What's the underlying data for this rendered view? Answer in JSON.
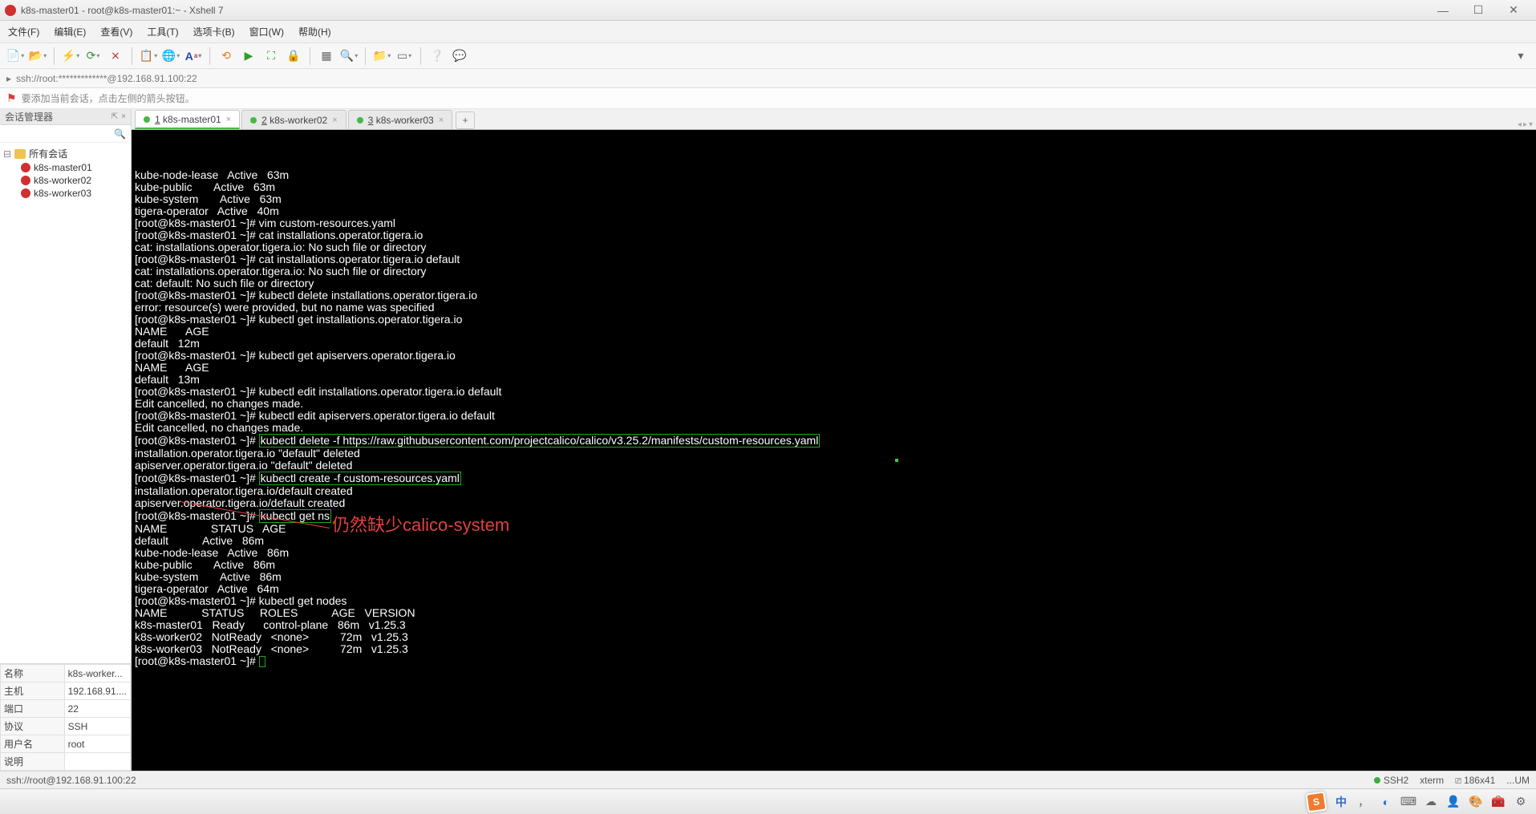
{
  "window": {
    "title": "k8s-master01 - root@k8s-master01:~ - Xshell 7",
    "min": "—",
    "max": "☐",
    "close": "✕"
  },
  "menu": [
    "文件(F)",
    "编辑(E)",
    "查看(V)",
    "工具(T)",
    "选项卡(B)",
    "窗口(W)",
    "帮助(H)"
  ],
  "address_icon": "▸",
  "address": "ssh://root:*************@192.168.91.100:22",
  "hint": "要添加当前会话，点击左侧的箭头按钮。",
  "sidebar": {
    "title": "会话管理器",
    "pin": "⇱",
    "close": "×",
    "root": "所有会话",
    "items": [
      "k8s-master01",
      "k8s-worker02",
      "k8s-worker03"
    ]
  },
  "props": [
    [
      "名称",
      "k8s-worker..."
    ],
    [
      "主机",
      "192.168.91...."
    ],
    [
      "端口",
      "22"
    ],
    [
      "协议",
      "SSH"
    ],
    [
      "用户名",
      "root"
    ],
    [
      "说明",
      ""
    ]
  ],
  "tabs": [
    {
      "n": "1",
      "label": "k8s-master01",
      "active": true
    },
    {
      "n": "2",
      "label": "k8s-worker02",
      "active": false
    },
    {
      "n": "3",
      "label": "k8s-worker03",
      "active": false
    }
  ],
  "term": {
    "lines": [
      "kube-node-lease   Active   63m",
      "kube-public       Active   63m",
      "kube-system       Active   63m",
      "tigera-operator   Active   40m",
      "[root@k8s-master01 ~]# vim custom-resources.yaml",
      "[root@k8s-master01 ~]# cat installations.operator.tigera.io",
      "cat: installations.operator.tigera.io: No such file or directory",
      "[root@k8s-master01 ~]# cat installations.operator.tigera.io default",
      "cat: installations.operator.tigera.io: No such file or directory",
      "cat: default: No such file or directory",
      "[root@k8s-master01 ~]# kubectl delete installations.operator.tigera.io",
      "error: resource(s) were provided, but no name was specified",
      "[root@k8s-master01 ~]# kubectl get installations.operator.tigera.io",
      "NAME      AGE",
      "default   12m",
      "[root@k8s-master01 ~]# kubectl get apiservers.operator.tigera.io",
      "NAME      AGE",
      "default   13m",
      "[root@k8s-master01 ~]# kubectl edit installations.operator.tigera.io default",
      "Edit cancelled, no changes made.",
      "[root@k8s-master01 ~]# kubectl edit apiservers.operator.tigera.io default",
      "Edit cancelled, no changes made."
    ],
    "prompt": "[root@k8s-master01 ~]# ",
    "hl1": "kubectl delete -f https://raw.githubusercontent.com/projectcalico/calico/v3.25.2/manifests/custom-resources.yaml",
    "after1a": "installation.operator.tigera.io \"default\" deleted",
    "after1b": "apiserver.operator.tigera.io \"default\" deleted",
    "hl2": "kubectl create -f custom-resources.yaml",
    "after2a": "installation.operator.tigera.io/default created",
    "after2b": "apiserver.operator.tigera.io/default created",
    "hl3": "kubectl get ns",
    "ns_lines": [
      "NAME              STATUS   AGE",
      "default           Active   86m",
      "kube-node-lease   Active   86m",
      "kube-public       Active   86m",
      "kube-system       Active   86m",
      "tigera-operator   Active   64m"
    ],
    "nodes_cmd": "[root@k8s-master01 ~]# kubectl get nodes",
    "nodes_lines": [
      "NAME           STATUS     ROLES           AGE   VERSION",
      "k8s-master01   Ready      control-plane   86m   v1.25.3",
      "k8s-worker02   NotReady   <none>          72m   v1.25.3",
      "k8s-worker03   NotReady   <none>          72m   v1.25.3"
    ],
    "annotation": "仍然缺少calico-system"
  },
  "status": {
    "left": "ssh://root@192.168.91.100:22",
    "ssh": "SSH2",
    "term": "xterm",
    "size": "186x41",
    "rest": "...UM"
  },
  "ime": "中"
}
